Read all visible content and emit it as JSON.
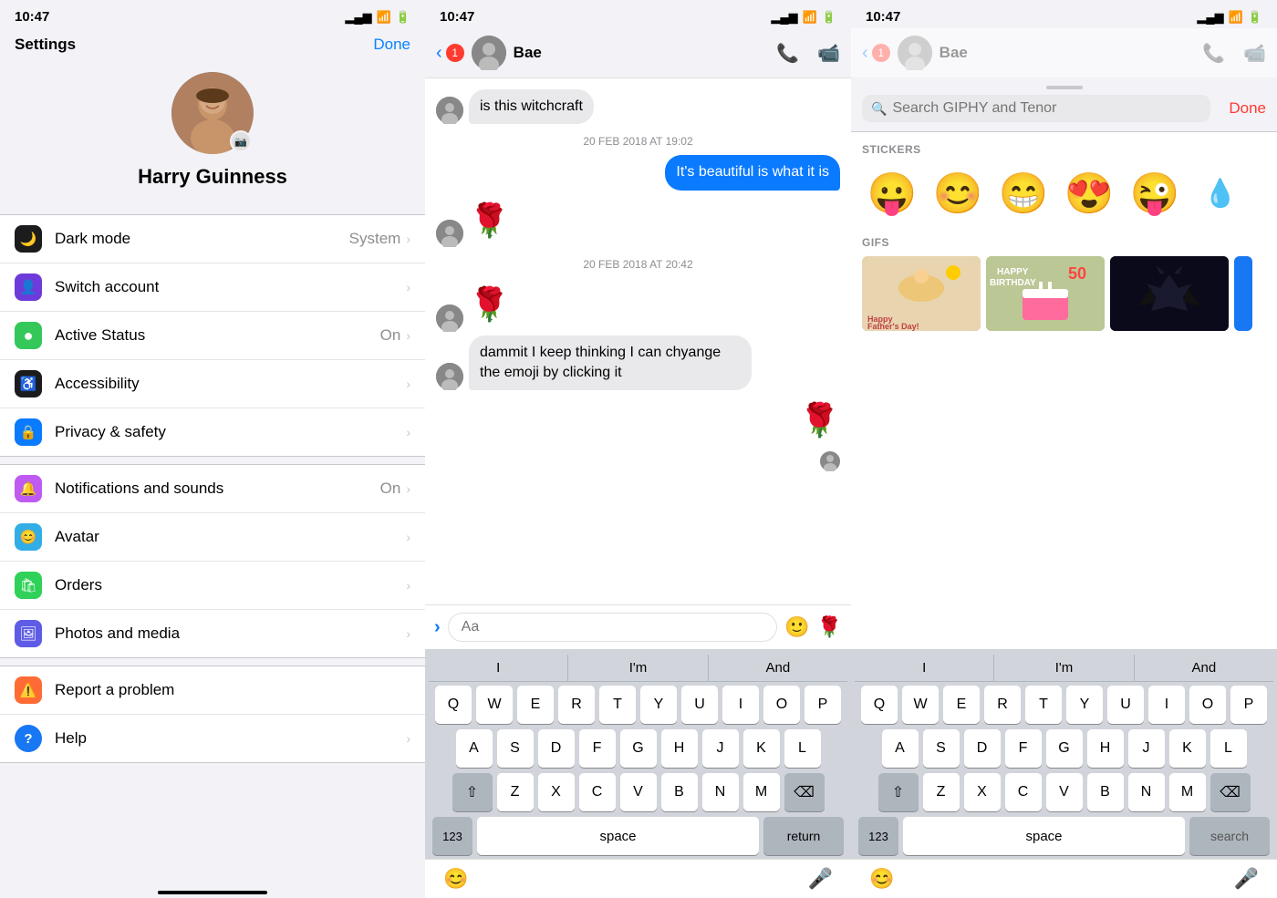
{
  "panel1": {
    "status_time": "10:47",
    "title": "Settings",
    "done_label": "Done",
    "profile_name": "Harry Guinness",
    "settings_groups": [
      {
        "items": [
          {
            "id": "dark-mode",
            "label": "Dark mode",
            "value": "System",
            "icon_color": "dark",
            "icon": "🌙",
            "has_chevron": true
          },
          {
            "id": "switch-account",
            "label": "Switch account",
            "value": "",
            "icon_color": "purple",
            "icon": "👤",
            "has_chevron": true
          },
          {
            "id": "active-status",
            "label": "Active Status",
            "value": "On",
            "icon_color": "green",
            "icon": "●",
            "has_chevron": true
          },
          {
            "id": "accessibility",
            "label": "Accessibility",
            "value": "",
            "icon_color": "black",
            "icon": "⑧",
            "has_chevron": true
          },
          {
            "id": "privacy-safety",
            "label": "Privacy & safety",
            "value": "",
            "icon_color": "blue",
            "icon": "🔒",
            "has_chevron": true
          }
        ]
      },
      {
        "items": [
          {
            "id": "notifications",
            "label": "Notifications and sounds",
            "value": "On",
            "icon_color": "purple2",
            "icon": "🔔",
            "has_chevron": true
          },
          {
            "id": "avatar",
            "label": "Avatar",
            "value": "",
            "icon_color": "teal",
            "icon": "😊",
            "has_chevron": true
          },
          {
            "id": "orders",
            "label": "Orders",
            "value": "",
            "icon_color": "green2",
            "icon": "🛍",
            "has_chevron": true
          },
          {
            "id": "photos-media",
            "label": "Photos and media",
            "value": "",
            "icon_color": "indigo",
            "icon": "🖼",
            "has_chevron": true
          }
        ]
      },
      {
        "items": [
          {
            "id": "report-problem",
            "label": "Report a problem",
            "value": "",
            "icon_color": "orange",
            "icon": "⚠️",
            "has_chevron": false
          },
          {
            "id": "help",
            "label": "Help",
            "value": "",
            "icon_color": "circle-blue",
            "icon": "?",
            "has_chevron": true
          }
        ]
      }
    ]
  },
  "panel2": {
    "status_time": "10:47",
    "contact_name": "Bae",
    "badge_count": "1",
    "messages": [
      {
        "id": "msg1",
        "type": "received",
        "text": "is this witchcraft",
        "emoji": false
      },
      {
        "id": "ts1",
        "type": "timestamp",
        "text": "20 FEB 2018 AT 19:02"
      },
      {
        "id": "msg2",
        "type": "sent",
        "text": "It's beautiful is what it is",
        "emoji": false
      },
      {
        "id": "msg3",
        "type": "received",
        "text": "🌹",
        "emoji": true
      },
      {
        "id": "ts2",
        "type": "timestamp",
        "text": "20 FEB 2018 AT 20:42"
      },
      {
        "id": "msg4",
        "type": "received",
        "text": "🌹",
        "emoji": true
      },
      {
        "id": "msg5",
        "type": "received",
        "text": "dammit I keep thinking I can chyange the emoji by clicking it",
        "emoji": false
      },
      {
        "id": "msg6",
        "type": "sent",
        "text": "🌹",
        "emoji": true
      },
      {
        "id": "msg7",
        "type": "sent_avatar",
        "text": "👤",
        "emoji": true
      }
    ],
    "input_placeholder": "Aa",
    "suggestions": [
      "I",
      "I'm",
      "And"
    ],
    "keyboard_rows": [
      [
        "Q",
        "W",
        "E",
        "R",
        "T",
        "Y",
        "U",
        "I",
        "O",
        "P"
      ],
      [
        "A",
        "S",
        "D",
        "F",
        "G",
        "H",
        "J",
        "K",
        "L"
      ],
      [
        "Z",
        "X",
        "C",
        "V",
        "B",
        "N",
        "M"
      ]
    ],
    "space_label": "space",
    "return_label": "return"
  },
  "panel3": {
    "status_time": "10:47",
    "contact_name": "Bae",
    "badge_count": "1",
    "search_placeholder": "Search GIPHY and Tenor",
    "done_label": "Done",
    "stickers_label": "STICKERS",
    "gifs_label": "GIFS",
    "stickers": [
      "😛",
      "😊",
      "😁",
      "😍",
      "😜",
      "💧"
    ],
    "gifs": [
      {
        "label": "Father's Day",
        "color": "warm"
      },
      {
        "label": "HAPPY BIRTHDAY 50",
        "color": "birthday"
      },
      {
        "label": "Batman",
        "color": "dark"
      }
    ],
    "suggestions": [
      "I",
      "I'm",
      "And"
    ],
    "keyboard_rows": [
      [
        "Q",
        "W",
        "E",
        "R",
        "T",
        "Y",
        "U",
        "I",
        "O",
        "P"
      ],
      [
        "A",
        "S",
        "D",
        "F",
        "G",
        "H",
        "J",
        "K",
        "L"
      ],
      [
        "Z",
        "X",
        "C",
        "V",
        "B",
        "N",
        "M"
      ]
    ],
    "space_label": "space",
    "search_key_label": "search"
  }
}
